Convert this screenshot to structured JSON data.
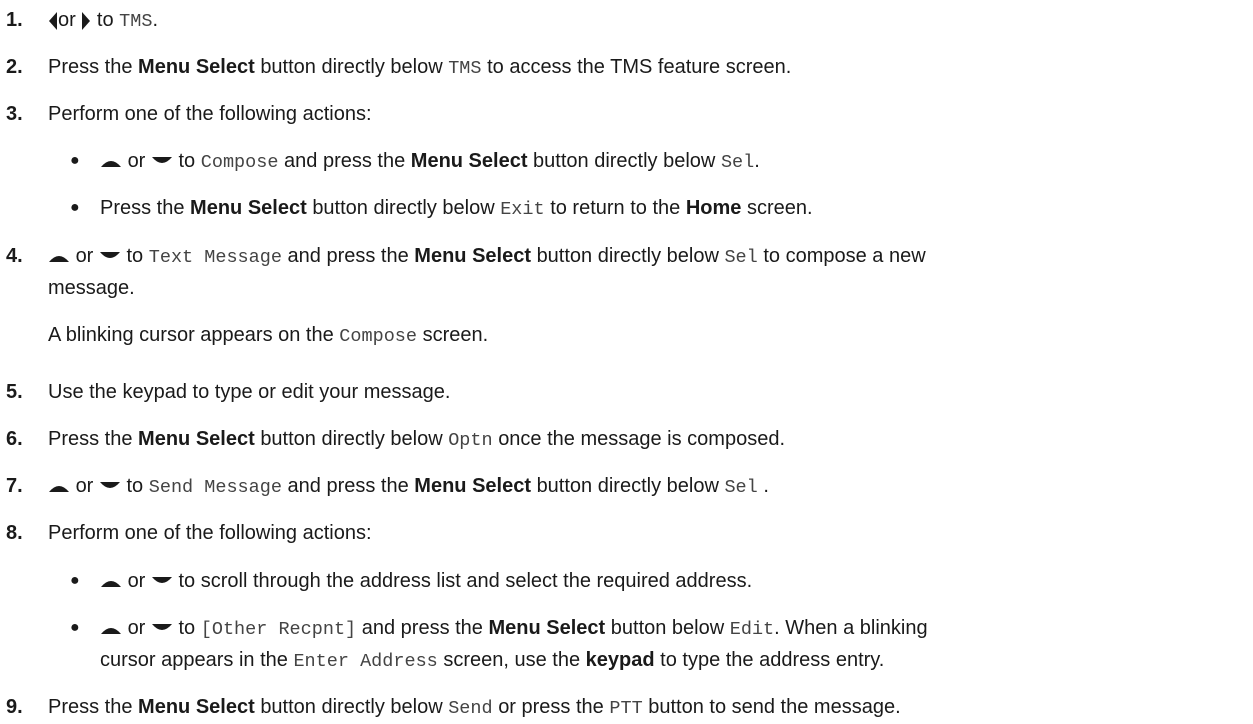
{
  "steps": [
    {
      "num": "1.",
      "parts": [
        "or",
        "to",
        "TMS",
        "."
      ]
    },
    {
      "num": "2.",
      "parts": [
        "Press the",
        "Menu Select",
        "button directly below",
        "TMS",
        "to access the TMS feature screen."
      ]
    },
    {
      "num": "3.",
      "text": "Perform one of the following actions:",
      "bullets": [
        {
          "parts": [
            "or",
            "to",
            "Compose",
            "and press the",
            "Menu Select",
            "button directly below",
            "Sel",
            "."
          ]
        },
        {
          "parts": [
            "Press the",
            "Menu Select",
            "button directly below",
            "Exit",
            "to return to the",
            "Home",
            "screen."
          ]
        }
      ]
    },
    {
      "num": "4.",
      "parts": [
        "or",
        "to",
        "Text Message",
        "and press the",
        "Menu Select",
        "button directly below",
        "Sel",
        "to compose a new"
      ],
      "cont": "message.",
      "note": [
        "A blinking cursor appears on the",
        "Compose",
        "screen."
      ]
    },
    {
      "num": "5.",
      "text": "Use the keypad to type or edit your message."
    },
    {
      "num": "6.",
      "parts": [
        "Press the",
        "Menu Select",
        "button directly below",
        "Optn",
        "once the message is composed."
      ]
    },
    {
      "num": "7.",
      "parts": [
        "or",
        "to",
        "Send Message",
        "and press the",
        "Menu Select",
        "button directly below",
        "Sel",
        "."
      ]
    },
    {
      "num": "8.",
      "text": "Perform one of the following actions:",
      "bullets": [
        {
          "parts": [
            "or",
            "to scroll through the address list and select the required address."
          ]
        },
        {
          "parts": [
            "or",
            "to",
            "[Other Recpnt]",
            "and press the",
            "Menu Select",
            "button below",
            "Edit",
            ". When a blinking"
          ],
          "cont": [
            "cursor appears in the",
            "Enter Address",
            "screen, use the",
            "keypad",
            "to type the address entry."
          ]
        }
      ]
    },
    {
      "num": "9.",
      "parts": [
        "Press the",
        "Menu Select",
        "button directly below",
        "Send",
        "or press the",
        "PTT",
        "button to send the message."
      ]
    }
  ],
  "icons": {
    "left": "left-arrow-icon",
    "right": "right-arrow-icon",
    "up": "up-arrow-icon",
    "down": "down-arrow-icon"
  },
  "bullet_glyph": "●"
}
